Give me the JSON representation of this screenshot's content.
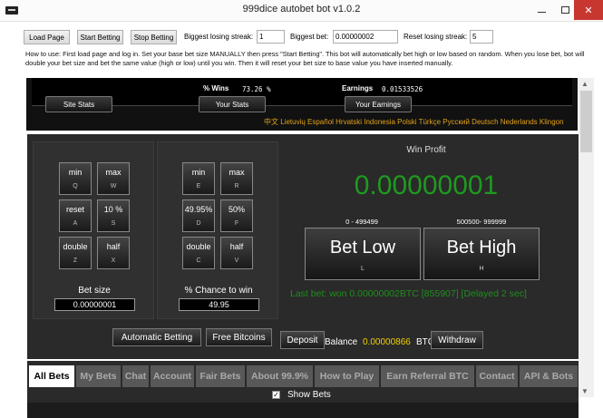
{
  "window": {
    "title": "999dice autobet bot v1.0.2"
  },
  "toolbar": {
    "load_page": "Load Page",
    "start_betting": "Start Betting",
    "stop_betting": "Stop Betting",
    "losing_streak_label": "Biggest losing streak:",
    "losing_streak_value": "1",
    "biggest_bet_label": "Biggest bet:",
    "biggest_bet_value": "0.00000002",
    "reset_streak_label": "Reset losing streak:",
    "reset_streak_value": "5"
  },
  "howto": "How to use: First load page and log in. Set your base bet size MANUALLY then press \"Start Betting\". This bot will automatically bet high or low based on random. When you lose bet, bot will double your bet size and bet the same value (high or low) until you win. Then it will reset your bet size to base value you have inserted manually.",
  "stats_panel": {
    "wins_label": "% Wins",
    "wins_value": "73.26 %",
    "earnings_label": "Earnings",
    "earnings_value": "0.01533526",
    "site_stats": "Site Stats",
    "your_stats": "Your Stats",
    "your_earnings": "Your Earnings",
    "languages": "中文 Lietuvių Español Hrvatski Indonesia Polski Türkçe Русский Deutsch Nederlands Klingon"
  },
  "bet_size_section": {
    "keys": [
      {
        "label": "min",
        "key": "Q"
      },
      {
        "label": "max",
        "key": "W"
      },
      {
        "label": "reset",
        "key": "A"
      },
      {
        "label": "10 %",
        "key": "S"
      },
      {
        "label": "double",
        "key": "Z"
      },
      {
        "label": "half",
        "key": "X"
      }
    ],
    "label": "Bet size",
    "value": "0.00000001"
  },
  "chance_section": {
    "keys": [
      {
        "label": "min",
        "key": "E"
      },
      {
        "label": "max",
        "key": "R"
      },
      {
        "label": "49.95%",
        "key": "D"
      },
      {
        "label": "50%",
        "key": "F"
      },
      {
        "label": "double",
        "key": "C"
      },
      {
        "label": "half",
        "key": "V"
      }
    ],
    "label": "% Chance to win",
    "value": "49.95"
  },
  "profit_section": {
    "label": "Win Profit",
    "value": "0.00000001",
    "low_range": "0 - 499499",
    "high_range": "500500- 999999",
    "bet_low": "Bet Low",
    "bet_low_key": "L",
    "bet_high": "Bet High",
    "bet_high_key": "H",
    "last_bet": "Last bet: won  0.00000002BTC       [855907] [Delayed 2 sec]"
  },
  "bottom_bar": {
    "automatic_betting": "Automatic Betting",
    "free_bitcoins": "Free Bitcoins",
    "deposit": "Deposit",
    "balance_label": "Balance",
    "balance_value": "0.00000866",
    "balance_unit": "BTC",
    "withdraw": "Withdraw"
  },
  "tabs": [
    "All Bets",
    "My Bets",
    "Chat",
    "Account",
    "Fair Bets",
    "About 99.9%",
    "How to Play",
    "Earn Referral BTC",
    "Contact",
    "API & Bots"
  ],
  "show_bets": {
    "label": "Show Bets",
    "checked": true
  }
}
